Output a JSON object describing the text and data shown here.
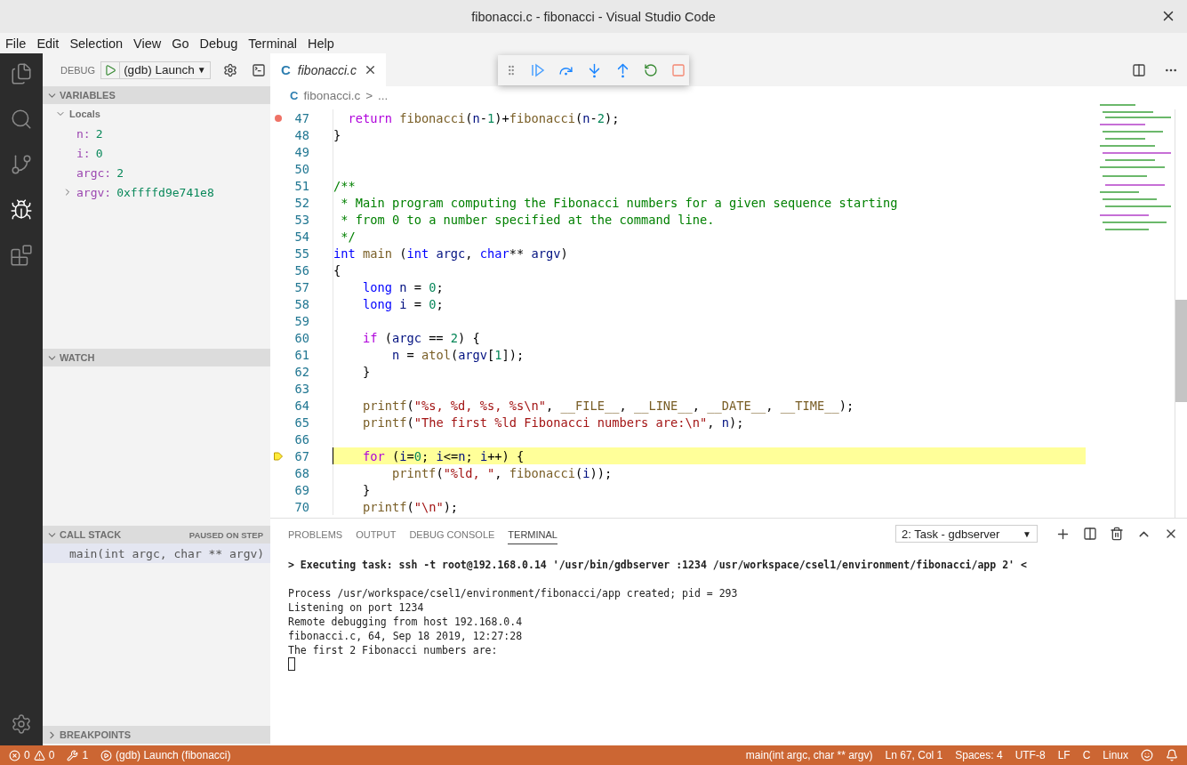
{
  "window": {
    "title": "fibonacci.c - fibonacci - Visual Studio Code"
  },
  "menu": [
    "File",
    "Edit",
    "Selection",
    "View",
    "Go",
    "Debug",
    "Terminal",
    "Help"
  ],
  "activity_bar": [
    {
      "kind": "files",
      "selected": false
    },
    {
      "kind": "search",
      "selected": false
    },
    {
      "kind": "scm",
      "selected": false
    },
    {
      "kind": "debug",
      "selected": true
    },
    {
      "kind": "extensions",
      "selected": false
    }
  ],
  "debug_toolbar": {
    "label": "DEBUG",
    "configuration": "(gdb) Launch",
    "caret": "▼"
  },
  "sidebar": {
    "sections": [
      {
        "kind": "variables",
        "title": "VARIABLES",
        "expanded": true,
        "scopes": [
          {
            "label": "Locals",
            "expanded": true,
            "children": [
              {
                "name": "n:",
                "value": "2",
                "kind": "value"
              },
              {
                "name": "i:",
                "value": "0",
                "kind": "value"
              },
              {
                "name": "argc:",
                "value": "2",
                "kind": "value"
              },
              {
                "name": "argv:",
                "value": "0xffffd9e741e8",
                "kind": "object"
              }
            ]
          }
        ]
      },
      {
        "kind": "watch",
        "title": "WATCH",
        "expanded": true
      },
      {
        "kind": "callstack",
        "title": "CALL STACK",
        "expanded": true,
        "status": "PAUSED ON STEP",
        "frames": [
          {
            "label": "main(int argc, char ** argv)",
            "selected": true
          }
        ]
      },
      {
        "kind": "breakpoints",
        "title": "BREAKPOINTS",
        "expanded": false
      }
    ]
  },
  "editor": {
    "tabs": [
      {
        "icon": "C",
        "label": "fibonacci.c",
        "selected": true
      }
    ],
    "breadcrumb": {
      "icon": "C",
      "file": "fibonacci.c",
      "separator": ">",
      "rest": "..."
    },
    "lines": [
      {
        "number": "47",
        "breakpoint": true,
        "current": false,
        "kind": "half",
        "tokens": [
          {
            "text": "return ",
            "kind": "kw"
          },
          {
            "text": "fibonacci",
            "kind": "fn"
          },
          {
            "text": "(",
            "kind": "plain"
          },
          {
            "text": "n",
            "kind": "var"
          },
          {
            "text": "-",
            "kind": "plain"
          },
          {
            "text": "1",
            "kind": "num"
          },
          {
            "text": ")+",
            "kind": "plain"
          },
          {
            "text": "fibonacci",
            "kind": "fn"
          },
          {
            "text": "(",
            "kind": "plain"
          },
          {
            "text": "n",
            "kind": "var"
          },
          {
            "text": "-",
            "kind": "plain"
          },
          {
            "text": "2",
            "kind": "num"
          },
          {
            "text": ");",
            "kind": "plain"
          }
        ]
      },
      {
        "number": "48",
        "breakpoint": false,
        "current": false,
        "tokens": [
          {
            "text": "}",
            "kind": "plain"
          }
        ]
      },
      {
        "number": "49",
        "breakpoint": false,
        "current": false
      },
      {
        "number": "50",
        "breakpoint": false,
        "current": false
      },
      {
        "number": "51",
        "breakpoint": false,
        "current": false,
        "tokens": [
          {
            "text": "/**",
            "kind": "comment"
          }
        ]
      },
      {
        "number": "52",
        "breakpoint": false,
        "current": false,
        "tokens": [
          {
            "text": " * Main program computing the Fibonacci numbers for a given sequence starting",
            "kind": "comment"
          }
        ]
      },
      {
        "number": "53",
        "breakpoint": false,
        "current": false,
        "tokens": [
          {
            "text": " * from 0 to a number specified at the command line.",
            "kind": "comment"
          }
        ]
      },
      {
        "number": "54",
        "breakpoint": false,
        "current": false,
        "tokens": [
          {
            "text": " */",
            "kind": "comment"
          }
        ]
      },
      {
        "number": "55",
        "breakpoint": false,
        "current": false,
        "tokens": [
          {
            "text": "int ",
            "kind": "type"
          },
          {
            "text": "main",
            "kind": "fn"
          },
          {
            "text": " (",
            "kind": "plain"
          },
          {
            "text": "int ",
            "kind": "type"
          },
          {
            "text": "argc",
            "kind": "var"
          },
          {
            "text": ", ",
            "kind": "plain"
          },
          {
            "text": "char",
            "kind": "type"
          },
          {
            "text": "** ",
            "kind": "plain"
          },
          {
            "text": "argv",
            "kind": "var"
          },
          {
            "text": ")",
            "kind": "plain"
          }
        ]
      },
      {
        "number": "56",
        "breakpoint": false,
        "current": false,
        "tokens": [
          {
            "text": "{",
            "kind": "plain"
          }
        ]
      },
      {
        "number": "57",
        "breakpoint": false,
        "current": false,
        "kind": "block",
        "tokens": [
          {
            "text": "long ",
            "kind": "type"
          },
          {
            "text": "n",
            "kind": "var"
          },
          {
            "text": " = ",
            "kind": "plain"
          },
          {
            "text": "0",
            "kind": "num"
          },
          {
            "text": ";",
            "kind": "plain"
          }
        ]
      },
      {
        "number": "58",
        "breakpoint": false,
        "current": false,
        "kind": "block",
        "tokens": [
          {
            "text": "long ",
            "kind": "type"
          },
          {
            "text": "i",
            "kind": "var"
          },
          {
            "text": " = ",
            "kind": "plain"
          },
          {
            "text": "0",
            "kind": "num"
          },
          {
            "text": ";",
            "kind": "plain"
          }
        ]
      },
      {
        "number": "59",
        "breakpoint": false,
        "current": false
      },
      {
        "number": "60",
        "breakpoint": false,
        "current": false,
        "kind": "block",
        "tokens": [
          {
            "text": "if",
            "kind": "kw"
          },
          {
            "text": " (",
            "kind": "plain"
          },
          {
            "text": "argc",
            "kind": "var"
          },
          {
            "text": " == ",
            "kind": "plain"
          },
          {
            "text": "2",
            "kind": "num"
          },
          {
            "text": ") {",
            "kind": "plain"
          }
        ]
      },
      {
        "number": "61",
        "breakpoint": false,
        "current": false,
        "kind": "nested",
        "tokens": [
          {
            "text": "n",
            "kind": "var"
          },
          {
            "text": " = ",
            "kind": "plain"
          },
          {
            "text": "atol",
            "kind": "fn"
          },
          {
            "text": "(",
            "kind": "plain"
          },
          {
            "text": "argv",
            "kind": "var"
          },
          {
            "text": "[",
            "kind": "plain"
          },
          {
            "text": "1",
            "kind": "num"
          },
          {
            "text": "]);",
            "kind": "plain"
          }
        ]
      },
      {
        "number": "62",
        "breakpoint": false,
        "current": false,
        "kind": "block",
        "tokens": [
          {
            "text": "}",
            "kind": "plain"
          }
        ]
      },
      {
        "number": "63",
        "breakpoint": false,
        "current": false
      },
      {
        "number": "64",
        "breakpoint": false,
        "current": false,
        "kind": "block",
        "tokens": [
          {
            "text": "printf",
            "kind": "fn"
          },
          {
            "text": "(",
            "kind": "plain"
          },
          {
            "text": "\"%s, %d, %s, %s\\n\"",
            "kind": "str"
          },
          {
            "text": ", ",
            "kind": "plain"
          },
          {
            "text": "__FILE__",
            "kind": "fn"
          },
          {
            "text": ", ",
            "kind": "plain"
          },
          {
            "text": "__LINE__",
            "kind": "fn"
          },
          {
            "text": ", ",
            "kind": "plain"
          },
          {
            "text": "__DATE__",
            "kind": "fn"
          },
          {
            "text": ", ",
            "kind": "plain"
          },
          {
            "text": "__TIME__",
            "kind": "fn"
          },
          {
            "text": ");",
            "kind": "plain"
          }
        ]
      },
      {
        "number": "65",
        "breakpoint": false,
        "current": false,
        "kind": "block",
        "tokens": [
          {
            "text": "printf",
            "kind": "fn"
          },
          {
            "text": "(",
            "kind": "plain"
          },
          {
            "text": "\"The first %ld Fibonacci numbers are:\\n\"",
            "kind": "str"
          },
          {
            "text": ", ",
            "kind": "plain"
          },
          {
            "text": "n",
            "kind": "var"
          },
          {
            "text": ");",
            "kind": "plain"
          }
        ]
      },
      {
        "number": "66",
        "breakpoint": false,
        "current": false
      },
      {
        "number": "67",
        "breakpoint": false,
        "current": true,
        "kind": "block",
        "tokens": [
          {
            "text": "for",
            "kind": "kw"
          },
          {
            "text": " (",
            "kind": "plain"
          },
          {
            "text": "i",
            "kind": "var"
          },
          {
            "text": "=",
            "kind": "plain"
          },
          {
            "text": "0",
            "kind": "num"
          },
          {
            "text": "; ",
            "kind": "plain"
          },
          {
            "text": "i",
            "kind": "var"
          },
          {
            "text": "<=",
            "kind": "plain"
          },
          {
            "text": "n",
            "kind": "var"
          },
          {
            "text": "; ",
            "kind": "plain"
          },
          {
            "text": "i",
            "kind": "var"
          },
          {
            "text": "++) {",
            "kind": "plain"
          }
        ]
      },
      {
        "number": "68",
        "breakpoint": false,
        "current": false,
        "kind": "nested",
        "tokens": [
          {
            "text": "printf",
            "kind": "fn"
          },
          {
            "text": "(",
            "kind": "plain"
          },
          {
            "text": "\"%ld, \"",
            "kind": "str"
          },
          {
            "text": ", ",
            "kind": "plain"
          },
          {
            "text": "fibonacci",
            "kind": "fn"
          },
          {
            "text": "(",
            "kind": "plain"
          },
          {
            "text": "i",
            "kind": "var"
          },
          {
            "text": "));",
            "kind": "plain"
          }
        ]
      },
      {
        "number": "69",
        "breakpoint": false,
        "current": false,
        "kind": "block",
        "tokens": [
          {
            "text": "}",
            "kind": "plain"
          }
        ]
      },
      {
        "number": "70",
        "breakpoint": false,
        "current": false,
        "kind": "block",
        "tokens": [
          {
            "text": "printf",
            "kind": "fn"
          },
          {
            "text": "(",
            "kind": "plain"
          },
          {
            "text": "\"\\n\"",
            "kind": "str"
          },
          {
            "text": ");",
            "kind": "plain"
          }
        ]
      }
    ]
  },
  "panel": {
    "tabs": [
      {
        "label": "PROBLEMS",
        "selected": false
      },
      {
        "label": "OUTPUT",
        "selected": false
      },
      {
        "label": "DEBUG CONSOLE",
        "selected": false
      },
      {
        "label": "TERMINAL",
        "selected": true
      }
    ],
    "terminal_select": {
      "value": "2: Task - gdbserver",
      "caret": "▼"
    },
    "terminal_lines": [
      {
        "text": "> Executing task: ssh -t root@192.168.0.14 '/usr/bin/gdbserver :1234 /usr/workspace/csel1/environment/fibonacci/app 2' <",
        "kind": "command"
      },
      {
        "text": "Process /usr/workspace/csel1/environment/fibonacci/app created; pid = 293",
        "kind": "output"
      },
      {
        "text": "Listening on port 1234",
        "kind": "output"
      },
      {
        "text": "Remote debugging from host 192.168.0.4",
        "kind": "output"
      },
      {
        "text": "fibonacci.c, 64, Sep 18 2019, 12:27:28",
        "kind": "output"
      },
      {
        "text": "The first 2 Fibonacci numbers are:",
        "kind": "output"
      }
    ]
  },
  "status_bar": {
    "errors": "0",
    "warnings": "0",
    "tasks": "1",
    "launch": "(gdb) Launch (fibonacci)",
    "right": [
      {
        "text": "main(int argc, char ** argv)"
      },
      {
        "text": "Ln 67, Col 1"
      },
      {
        "text": "Spaces: 4"
      },
      {
        "text": "UTF-8"
      },
      {
        "text": "LF"
      },
      {
        "text": "C"
      },
      {
        "text": "Linux"
      }
    ]
  }
}
